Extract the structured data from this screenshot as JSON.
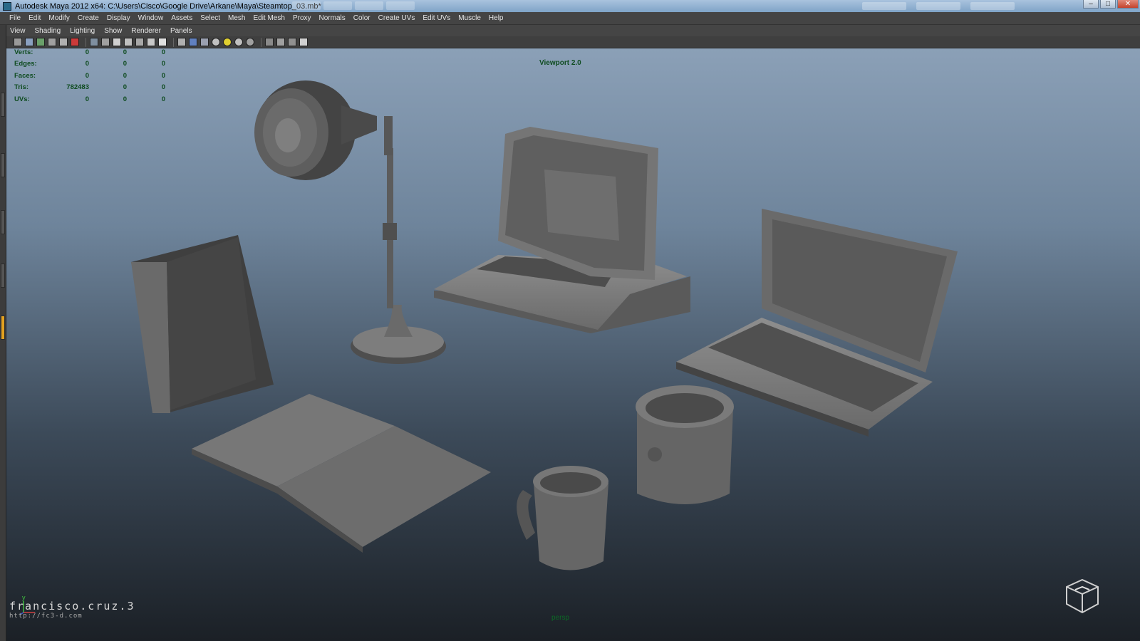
{
  "titlebar": {
    "title": "Autodesk Maya 2012 x64: C:\\Users\\Cisco\\Google Drive\\Arkane\\Maya\\Steamtop_03.mb*",
    "minimize_glyph": "–",
    "maximize_glyph": "□",
    "close_glyph": "✕"
  },
  "main_menu": [
    "File",
    "Edit",
    "Modify",
    "Create",
    "Display",
    "Window",
    "Assets",
    "Select",
    "Mesh",
    "Edit Mesh",
    "Proxy",
    "Normals",
    "Color",
    "Create UVs",
    "Edit UVs",
    "Muscle",
    "Help"
  ],
  "panel_menu": [
    "View",
    "Shading",
    "Lighting",
    "Show",
    "Renderer",
    "Panels"
  ],
  "toolbar_icons": [
    "select-camera-icon",
    "camera-attributes-icon",
    "bookmark-icon",
    "image-plane-icon",
    "2d-pan-icon",
    "grease-pencil-icon",
    "grid-icon",
    "film-gate-icon",
    "resolution-gate-icon",
    "gate-mask-icon",
    "field-chart-icon",
    "safe-action-icon",
    "safe-title-icon",
    "wireframe-icon",
    "smooth-shade-icon",
    "wireframe-on-shaded-icon",
    "textured-icon",
    "use-all-lights-icon",
    "shadows-icon",
    "screen-space-ao-icon",
    "isolate-select-icon",
    "xray-icon",
    "xray-joints-icon",
    "xray-active-icon"
  ],
  "hud": {
    "rows": [
      {
        "label": "Verts:",
        "values": [
          "0",
          "0",
          "0"
        ]
      },
      {
        "label": "Edges:",
        "values": [
          "0",
          "0",
          "0"
        ]
      },
      {
        "label": "Faces:",
        "values": [
          "0",
          "0",
          "0"
        ]
      },
      {
        "label": "Tris:",
        "values": [
          "782483",
          "0",
          "0"
        ]
      },
      {
        "label": "UVs:",
        "values": [
          "0",
          "0",
          "0"
        ]
      }
    ]
  },
  "viewport": {
    "renderer_label": "Viewport 2.0",
    "camera_name": "persp",
    "axis_label": "y",
    "watermark_name": "francisco.cruz.3",
    "watermark_url": "http://fc3-d.com"
  },
  "colors": {
    "hud_text": "#0f4c20",
    "active_tab": "#e3a120",
    "model_gray": "#6f6f6f"
  }
}
